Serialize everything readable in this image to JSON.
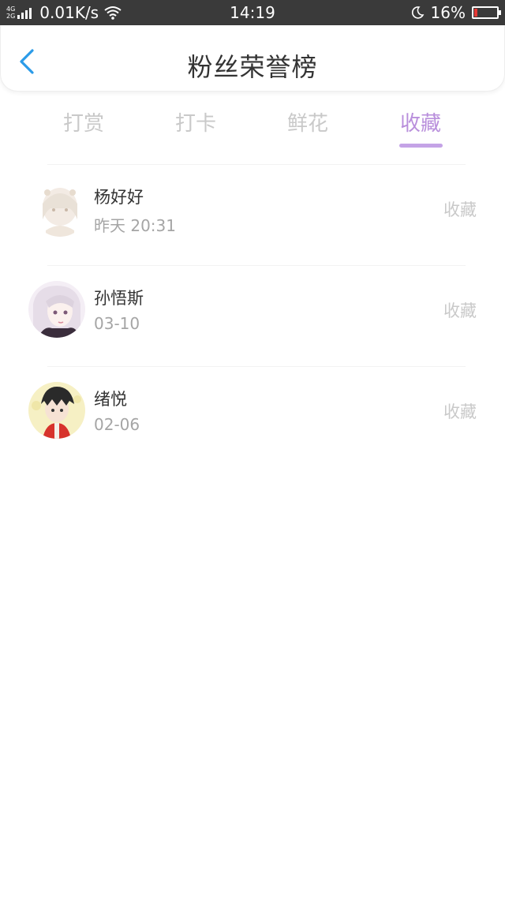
{
  "status_bar": {
    "net_type_top": "4G",
    "net_type_bottom": "2G",
    "speed": "0.01K/s",
    "time": "14:19",
    "battery": "16%",
    "battery_level": 0.16,
    "battery_color": "#e53935"
  },
  "header": {
    "title": "粉丝荣誉榜",
    "back_icon": "chevron-left-icon",
    "accent": "#2b9be8"
  },
  "tabs": [
    {
      "label": "打赏",
      "active": false
    },
    {
      "label": "打卡",
      "active": false
    },
    {
      "label": "鲜花",
      "active": false
    },
    {
      "label": "收藏",
      "active": true
    }
  ],
  "tab_active_color": "#b98fdc",
  "fans": [
    {
      "name": "杨好好",
      "time": "昨天 20:31",
      "action": "收藏"
    },
    {
      "name": "孙悟斯",
      "time": "03-10",
      "action": "收藏"
    },
    {
      "name": "绪悦",
      "time": "02-06",
      "action": "收藏"
    }
  ]
}
